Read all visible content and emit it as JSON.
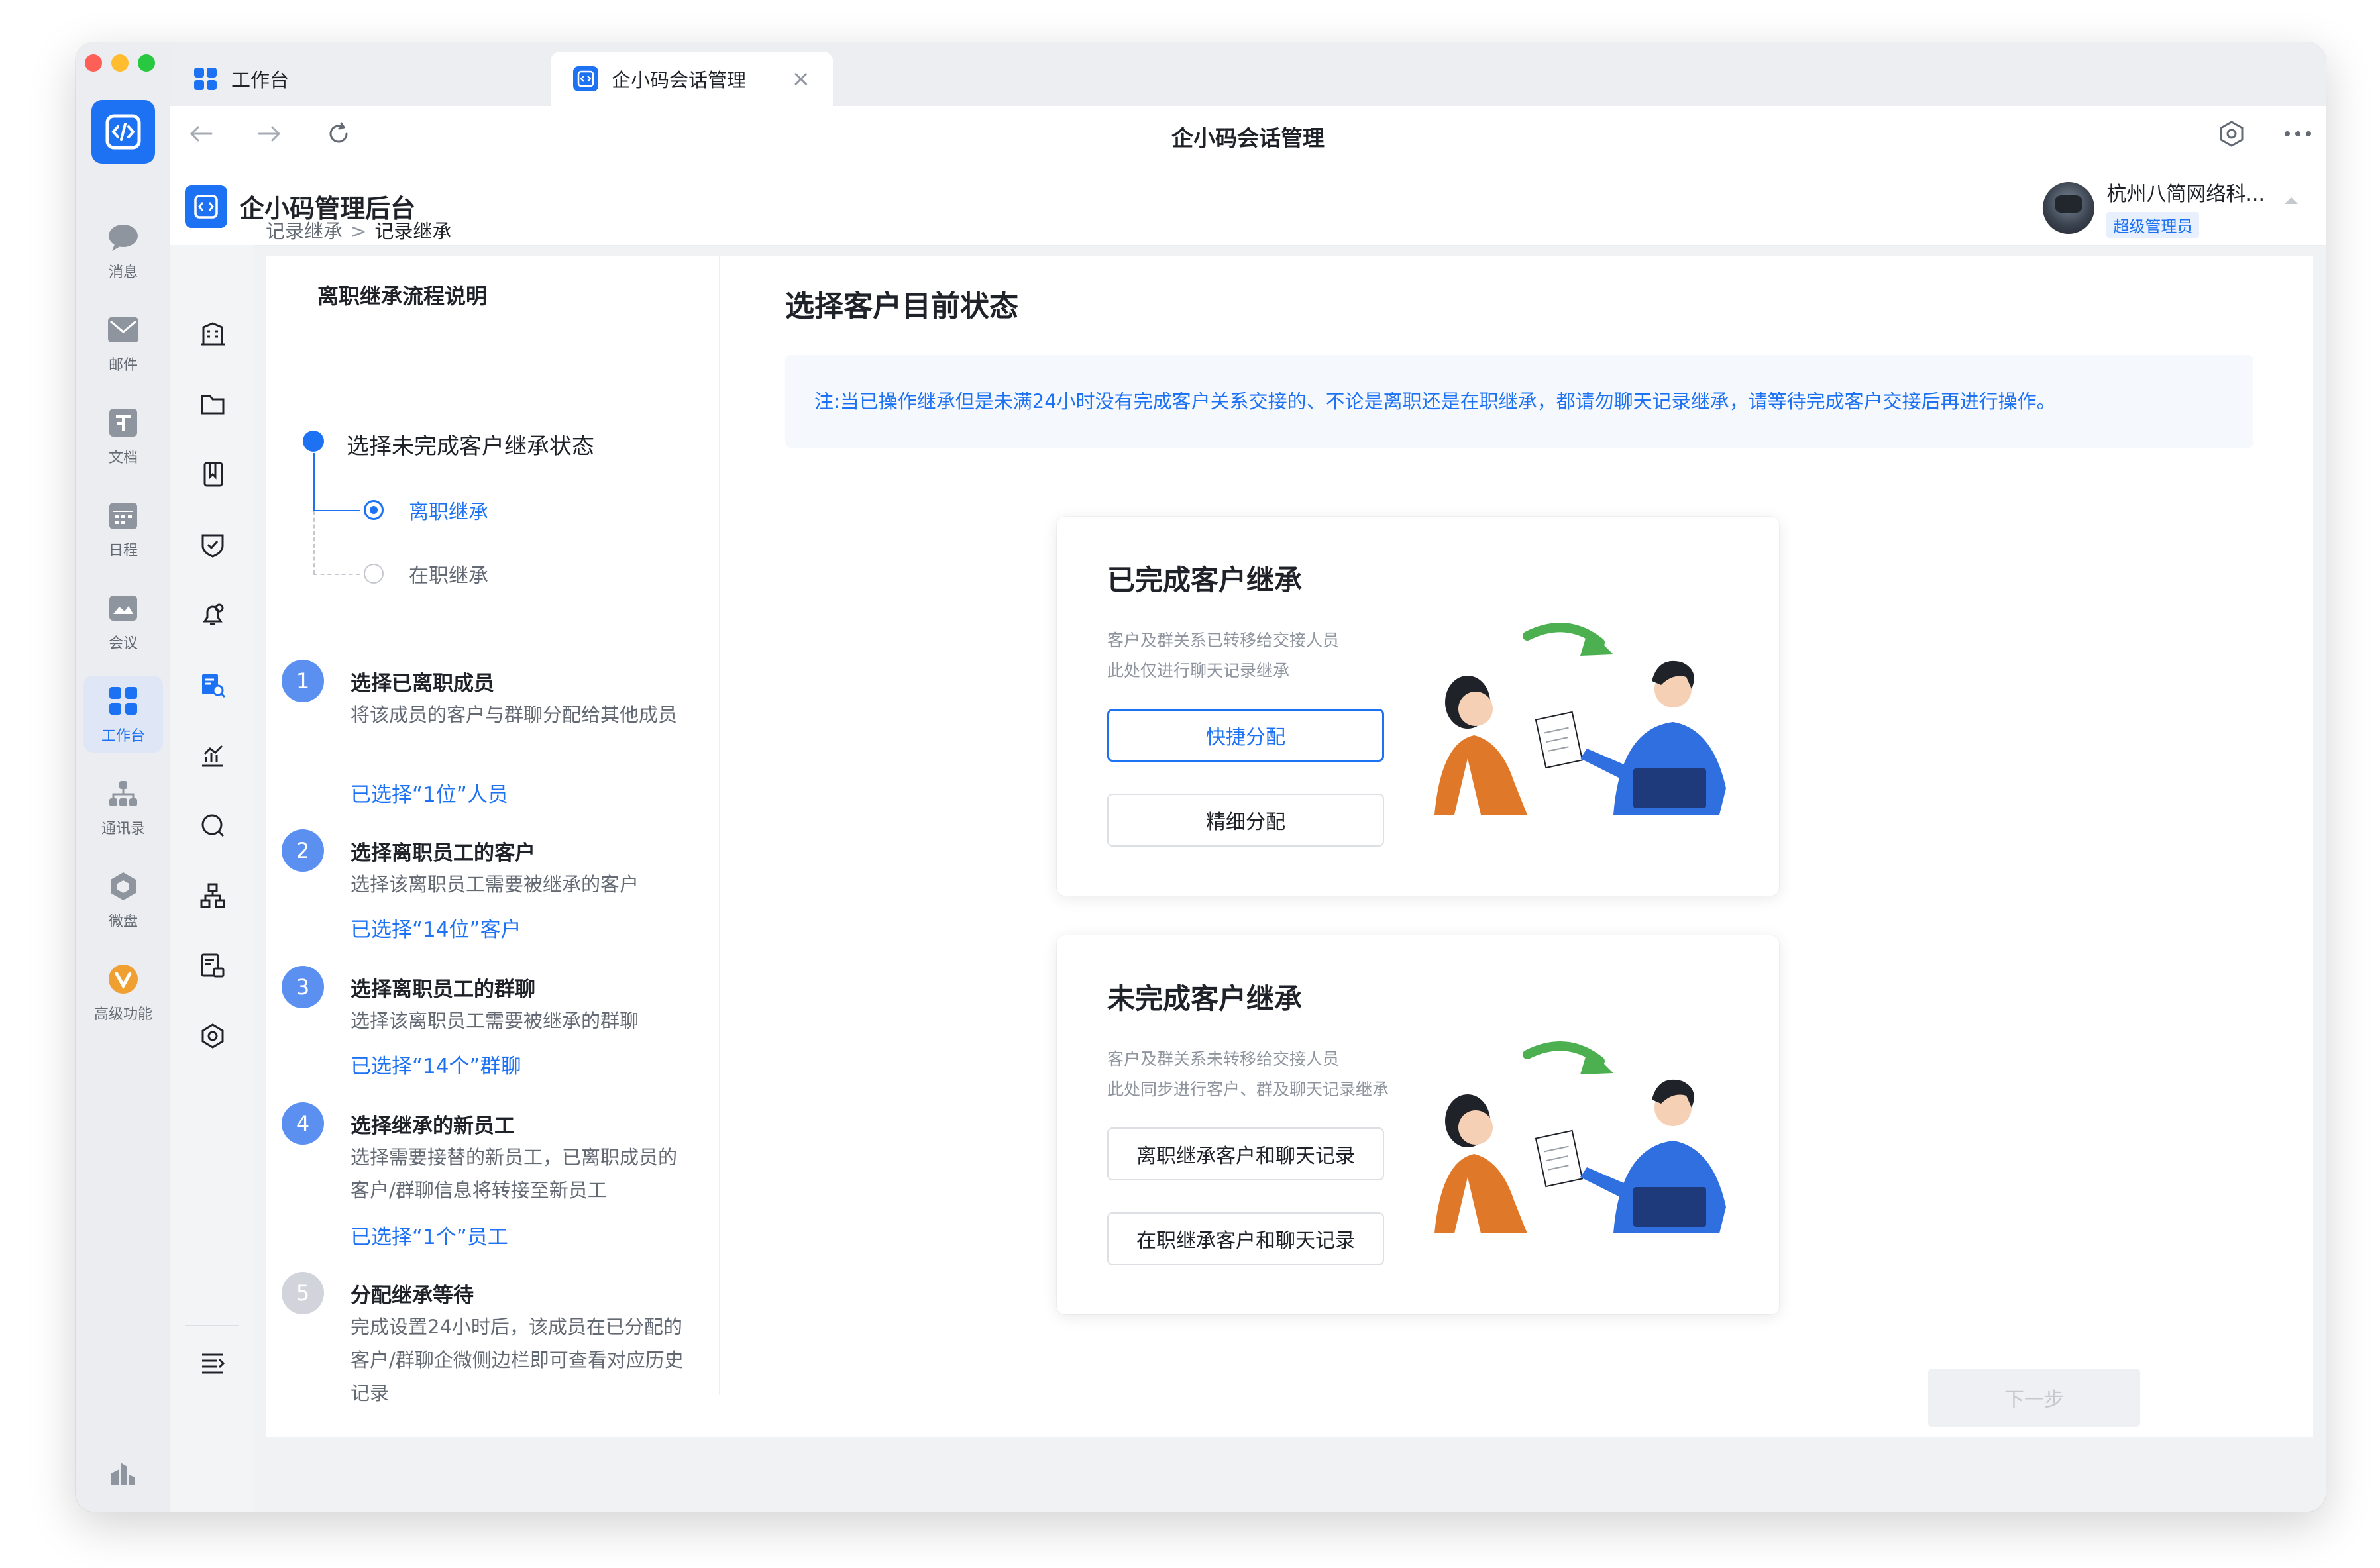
{
  "window": {
    "tabs": [
      {
        "label": "工作台"
      },
      {
        "label": "企小码会话管理",
        "close": "×"
      }
    ],
    "nav_title": "企小码会话管理"
  },
  "dock": {
    "items": [
      {
        "label": "消息",
        "icon": "message-icon"
      },
      {
        "label": "邮件",
        "icon": "mail-icon"
      },
      {
        "label": "文档",
        "icon": "document-icon"
      },
      {
        "label": "日程",
        "icon": "calendar-icon"
      },
      {
        "label": "会议",
        "icon": "meeting-icon"
      },
      {
        "label": "工作台",
        "icon": "workbench-icon",
        "active": true
      },
      {
        "label": "通讯录",
        "icon": "contacts-icon"
      },
      {
        "label": "微盘",
        "icon": "drive-icon"
      },
      {
        "label": "高级功能",
        "icon": "advanced-icon"
      }
    ]
  },
  "app": {
    "title": "企小码管理后台",
    "user": {
      "name": "杭州八简网络科...",
      "role": "超级管理员"
    }
  },
  "breadcrumb": {
    "parent": "记录继承",
    "sep": ">",
    "current": "记录继承"
  },
  "left_panel": {
    "title": "离职继承流程说明",
    "main_step": "选择未完成客户继承状态",
    "options": [
      {
        "label": "离职继承",
        "selected": true
      },
      {
        "label": "在职继承",
        "selected": false
      }
    ],
    "steps": [
      {
        "num": "1",
        "title": "选择已离职成员",
        "desc": "将该成员的客户与群聊分配给其他成员",
        "link": "已选择“1位”人员"
      },
      {
        "num": "2",
        "title": "选择离职员工的客户",
        "desc": "选择该离职员工需要被继承的客户",
        "link": "已选择“14位”客户"
      },
      {
        "num": "3",
        "title": "选择离职员工的群聊",
        "desc": "选择该离职员工需要被继承的群聊",
        "link": "已选择“14个”群聊"
      },
      {
        "num": "4",
        "title": "选择继承的新员工",
        "desc": "选择需要接替的新员工，已离职成员的客户/群聊信息将转接至新员工",
        "link": "已选择“1个”员工"
      },
      {
        "num": "5",
        "title": "分配继承等待",
        "desc": "完成设置24小时后，该成员在已分配的客户/群聊企微侧边栏即可查看对应历史记录"
      }
    ]
  },
  "main": {
    "title": "选择客户目前状态",
    "note": "注:当已操作继承但是未满24小时没有完成客户关系交接的、不论是离职还是在职继承，都请勿聊天记录继承，请等待完成客户交接后再进行操作。",
    "cards": [
      {
        "title": "已完成客户继承",
        "desc1": "客户及群关系已转移给交接人员",
        "desc2": "此处仅进行聊天记录继承",
        "btn1": "快捷分配",
        "btn2": "精细分配"
      },
      {
        "title": "未完成客户继承",
        "desc1": "客户及群关系未转移给交接人员",
        "desc2": "此处同步进行客户、群及聊天记录继承",
        "btn1": "离职继承客户和聊天记录",
        "btn2": "在职继承客户和聊天记录"
      }
    ],
    "next": "下一步"
  },
  "colors": {
    "accent": "#1d72f3",
    "note_bg": "#f5f8fd",
    "arrow_green": "#4caf50",
    "orange": "#e0782a"
  }
}
